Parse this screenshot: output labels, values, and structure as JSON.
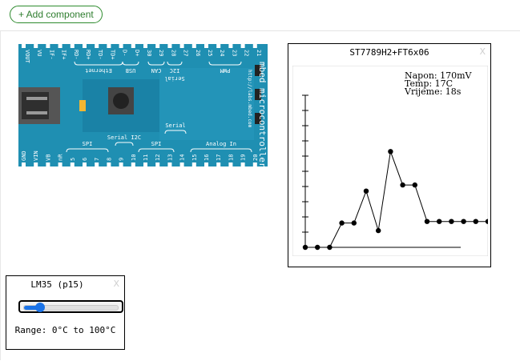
{
  "toolbar": {
    "add_label": "+ Add component"
  },
  "board": {
    "top_pins": [
      "VOUT",
      "VU",
      "IF-",
      "IF+",
      "RD-",
      "RD+",
      "TD-",
      "TD+",
      "D-",
      "D+",
      "30",
      "29",
      "28",
      "27",
      "26",
      "25",
      "24",
      "23",
      "22",
      "21"
    ],
    "bottom_pins": [
      "GND",
      "VIN",
      "VB",
      "nR",
      "5",
      "6",
      "7",
      "8",
      "9",
      "10",
      "11",
      "12",
      "13",
      "14",
      "15",
      "16",
      "17",
      "18",
      "19",
      "20"
    ],
    "top_groups": [
      "Ethernet",
      "USB",
      "CAN",
      "I2C",
      "PWM"
    ],
    "top_serial": "Serial",
    "bottom_groups": [
      "SPI",
      "Serial I2C",
      "SPI",
      "Serial",
      "Analog In"
    ],
    "side_text": "mbed microcontroller",
    "url_text": "http://labs.mbed.com",
    "colors": {
      "board": "#1f8fb2",
      "chip": "#1875a0",
      "text": "#ffffff"
    }
  },
  "lcd_panel": {
    "title": "ST7789H2+FT6x06",
    "close": "X",
    "lines": [
      "Napon: 170mV",
      "Temp: 17C",
      "Vrijeme: 18s"
    ]
  },
  "chart_data": {
    "type": "line",
    "title": "",
    "values": [
      0,
      0,
      0,
      16,
      16,
      37,
      11,
      63,
      41,
      41,
      17,
      17,
      17,
      17,
      17,
      17
    ],
    "ylim": [
      0,
      100
    ],
    "grid": false
  },
  "sensor_panel": {
    "title": "LM35 (p15)",
    "close": "X",
    "slider_fraction": 0.17,
    "range_label": "Range: 0°C to 100°C"
  },
  "colors": {
    "accent": "#1a73e8",
    "button_border": "#2e8b2e"
  }
}
